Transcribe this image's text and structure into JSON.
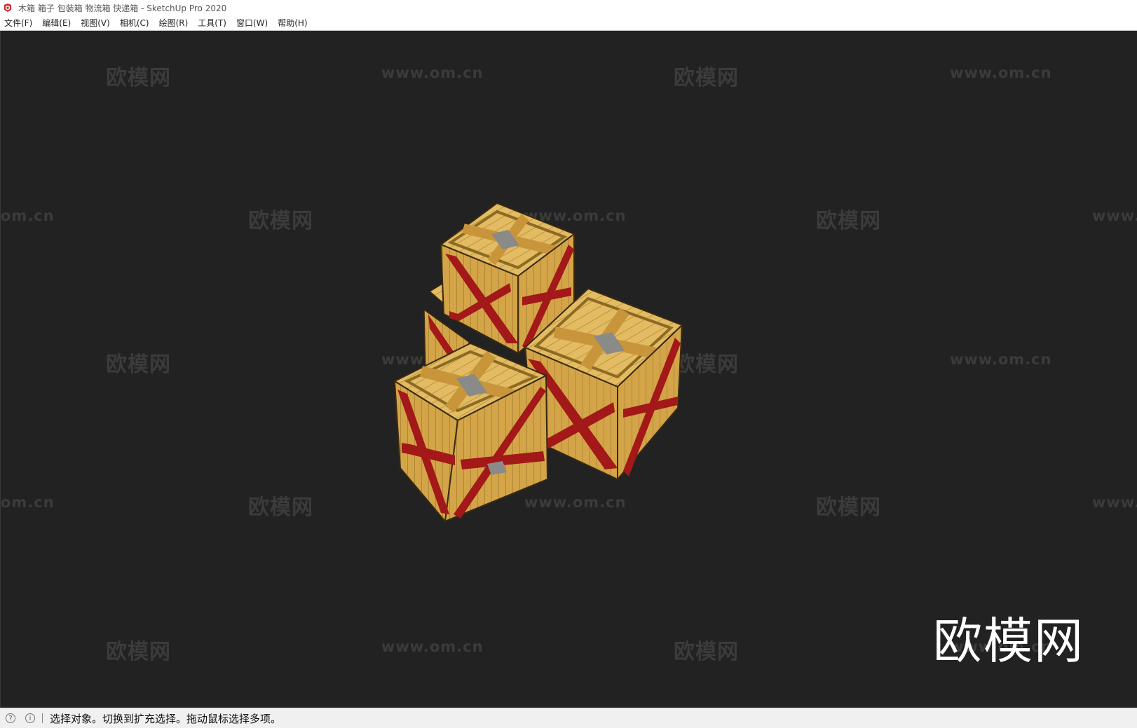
{
  "window": {
    "title": "木箱 箱子 包装箱 物流箱 快递箱 - SketchUp Pro 2020",
    "app_icon": "sketchup-logo-icon"
  },
  "menu": {
    "items": [
      {
        "label": "文件(F)"
      },
      {
        "label": "编辑(E)"
      },
      {
        "label": "视图(V)"
      },
      {
        "label": "相机(C)"
      },
      {
        "label": "绘图(R)"
      },
      {
        "label": "工具(T)"
      },
      {
        "label": "窗口(W)"
      },
      {
        "label": "帮助(H)"
      }
    ]
  },
  "viewport": {
    "background": "#222222",
    "watermark_cn": "欧模网",
    "watermark_url": "www.om.cn",
    "watermark_url_partial_left": "om.cn",
    "watermark_url_partial_right": "www.",
    "logo_text": "欧模网",
    "model_colors": {
      "wood": "#d9ad4e",
      "strap": "#a31818",
      "metal": "#8a8a88"
    }
  },
  "status": {
    "icons": [
      "geo-location-icon",
      "info-icon"
    ],
    "message": "选择对象。切换到扩充选择。拖动鼠标选择多项。"
  }
}
